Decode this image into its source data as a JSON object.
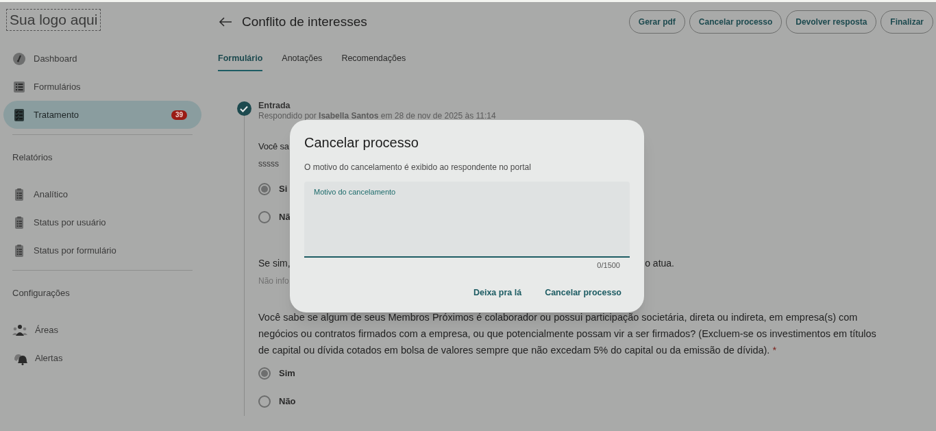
{
  "logo": "Sua logo aqui",
  "sidebar": {
    "groups": [
      {
        "items": [
          {
            "label": "Dashboard",
            "kind": "gauge",
            "selected": false
          },
          {
            "label": "Formulários",
            "kind": "list",
            "selected": false
          },
          {
            "label": "Tratamento",
            "kind": "checklist",
            "selected": true,
            "badge": "39"
          }
        ]
      },
      {
        "title": "Relatórios",
        "items": [
          {
            "label": "Analítico",
            "kind": "clipboard",
            "selected": false
          },
          {
            "label": "Status por usuário",
            "kind": "clipboard",
            "selected": false
          },
          {
            "label": "Status por formulário",
            "kind": "clipboard",
            "selected": false
          }
        ]
      },
      {
        "title": "Configurações",
        "items": [
          {
            "label": "Áreas",
            "kind": "people",
            "selected": false
          },
          {
            "label": "Alertas",
            "kind": "bell",
            "selected": false
          }
        ]
      }
    ]
  },
  "header": {
    "title": "Conflito de interesses",
    "buttons": [
      "Gerar pdf",
      "Cancelar processo",
      "Devolver resposta",
      "Finalizar"
    ]
  },
  "tabs": [
    {
      "label": "Formulário",
      "selected": true
    },
    {
      "label": "Anotações",
      "selected": false
    },
    {
      "label": "Recomendações",
      "selected": false
    }
  ],
  "step": {
    "title": "Entrada",
    "subtitle": "Respondido por **Isabella Santos** em 28 de nov de 2025 às 11:14",
    "checked": true
  },
  "questions": [
    {
      "text": "Você sa",
      "answer": "sssss",
      "options": [
        {
          "label": "Si",
          "selected": true
        },
        {
          "label": "Nã",
          "selected": false
        }
      ]
    },
    {
      "text": "Se sim,",
      "text_end": "o atua.",
      "answer": "Não info"
    },
    {
      "text": "Você sabe se algum de seus Membros Próximos é colaborador ou possui participação societária, direta ou indireta, em empresa(s) com negócios ou contratos firmados com a empresa, ou que potencialmente possam vir a ser firmados? (Excluem-se os investimentos em títulos de capital ou dívida cotados em bolsa de valores sempre que não excedam 5% do capital ou da emissão de dívida).",
      "required": "*",
      "options": [
        {
          "label": "Sim",
          "selected": true
        },
        {
          "label": "Não",
          "selected": false
        }
      ]
    }
  ],
  "dialog": {
    "title": "Cancelar processo",
    "description": "O motivo do cancelamento é exibido ao respondente no portal",
    "field": {
      "label": "Motivo do cancelamento",
      "counter": "0/1500"
    },
    "buttons": [
      "Deixa pra lá",
      "Cancelar processo"
    ]
  }
}
